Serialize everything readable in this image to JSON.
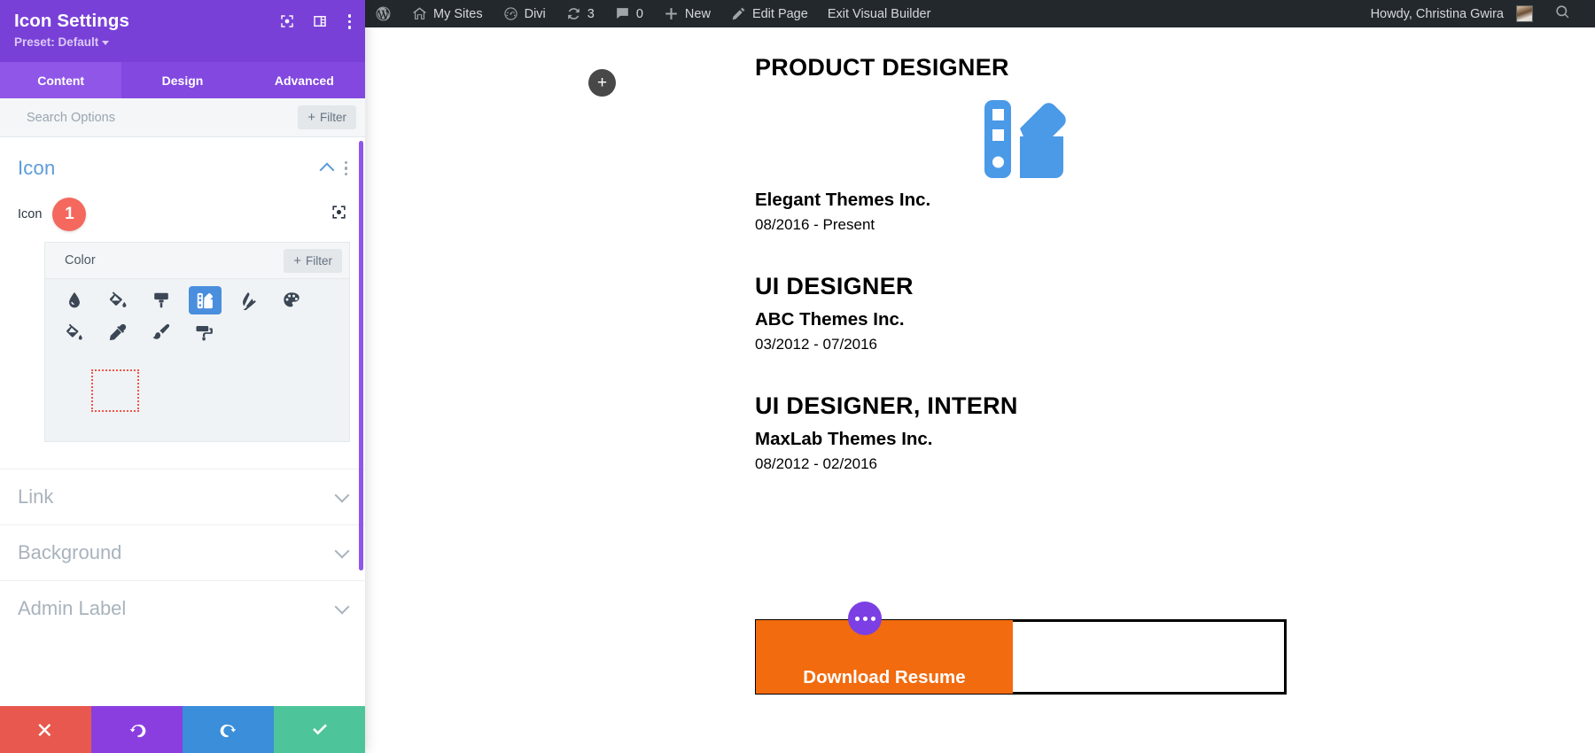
{
  "admin_bar": {
    "left_items": [
      {
        "id": "wp-logo",
        "icon": "wordpress-icon",
        "label": ""
      },
      {
        "id": "my-sites",
        "icon": "site-icon",
        "label": "My Sites"
      },
      {
        "id": "divi",
        "icon": "divi-icon",
        "label": "Divi"
      },
      {
        "id": "updates",
        "icon": "updates-icon",
        "label": "3"
      },
      {
        "id": "comments",
        "icon": "comment-icon",
        "label": "0"
      },
      {
        "id": "new",
        "icon": "plus-icon",
        "label": "New"
      },
      {
        "id": "edit-page",
        "icon": "pencil-icon",
        "label": "Edit Page"
      },
      {
        "id": "exit-visual-builder",
        "icon": "",
        "label": "Exit Visual Builder"
      }
    ],
    "greeting": "Howdy, Christina Gwira",
    "search_icon": "search-icon"
  },
  "panel": {
    "title": "Icon Settings",
    "preset_label": "Preset: Default",
    "header_icons": [
      "target-icon",
      "layout-icon",
      "kebab-menu-icon"
    ],
    "tabs": [
      {
        "label": "Content",
        "active": true
      },
      {
        "label": "Design",
        "active": false
      },
      {
        "label": "Advanced",
        "active": false
      }
    ],
    "search": {
      "placeholder": "Search Options",
      "value": ""
    },
    "filter_label": "Filter",
    "section": {
      "title": "Icon",
      "field_label": "Icon",
      "badge": "1",
      "picker": {
        "search_value": "Color",
        "search_placeholder": "Color",
        "filter_label": "Filter",
        "icons": [
          {
            "name": "tint-icon",
            "selected": false
          },
          {
            "name": "fill-drip-icon",
            "selected": false
          },
          {
            "name": "paint-brush-wide-icon",
            "selected": false
          },
          {
            "name": "swatchbook-icon",
            "selected": true
          },
          {
            "name": "tint-slash-icon",
            "selected": false
          },
          {
            "name": "palette-icon",
            "selected": false
          },
          {
            "name": "fill-bucket-icon",
            "selected": false
          },
          {
            "name": "eye-dropper-icon",
            "selected": false
          },
          {
            "name": "paint-brush-icon",
            "selected": false
          },
          {
            "name": "paint-roller-icon",
            "selected": false
          }
        ]
      }
    },
    "collapsed_sections": [
      {
        "label": "Link"
      },
      {
        "label": "Background"
      },
      {
        "label": "Admin Label"
      }
    ],
    "actions": [
      {
        "name": "cancel",
        "icon": "close-icon",
        "color": "#e8584e"
      },
      {
        "name": "undo",
        "icon": "undo-icon",
        "color": "#8b3ee0"
      },
      {
        "name": "redo",
        "icon": "redo-icon",
        "color": "#3b8ed9"
      },
      {
        "name": "save",
        "icon": "check-icon",
        "color": "#4ec49a"
      }
    ]
  },
  "canvas": {
    "add_module_label": "+",
    "jobs": [
      {
        "title": "PRODUCT DESIGNER",
        "company": "Elegant Themes Inc.",
        "dates": "08/2016 - Present"
      },
      {
        "title": "UI DESIGNER",
        "company": "ABC Themes Inc.",
        "dates": "03/2012 - 07/2016"
      },
      {
        "title": "UI DESIGNER, INTERN",
        "company": "MaxLab Themes Inc.",
        "dates": "08/2012 - 02/2016"
      }
    ],
    "download_button_label": "Download Resume",
    "swatch_icon_color": "#4a9ae8",
    "button_color": "#f26b0f"
  },
  "colors": {
    "panel_header": "#7940d8",
    "tab_active": "#8f56e8",
    "accent_blue": "#5a9bd8",
    "badge_red": "#f4685e",
    "selected_icon_bg": "#4a8ede"
  }
}
